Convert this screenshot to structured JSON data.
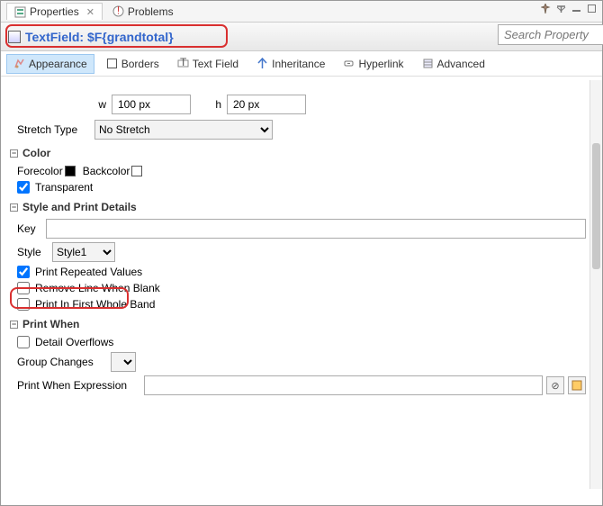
{
  "top_tabs": {
    "properties": "Properties",
    "problems": "Problems"
  },
  "title": "TextField: $F{grandtotal}",
  "search_placeholder": "Search Property",
  "sub_tabs": {
    "appearance": "Appearance",
    "borders": "Borders",
    "text_field": "Text Field",
    "inheritance": "Inheritance",
    "hyperlink": "Hyperlink",
    "advanced": "Advanced"
  },
  "size": {
    "w_label": "w",
    "w_value": "100 px",
    "h_label": "h",
    "h_value": "20 px"
  },
  "stretch": {
    "label": "Stretch Type",
    "value": "No Stretch"
  },
  "color": {
    "header": "Color",
    "forecolor": "Forecolor",
    "backcolor": "Backcolor",
    "transparent": "Transparent"
  },
  "style_section": {
    "header": "Style and Print Details",
    "key_label": "Key",
    "key_value": "",
    "style_label": "Style",
    "style_value": "Style1",
    "print_repeated": "Print Repeated Values",
    "remove_blank": "Remove Line When Blank",
    "print_first_band": "Print In First Whole Band"
  },
  "print_when": {
    "header": "Print When",
    "detail_overflows": "Detail Overflows",
    "group_changes": "Group Changes",
    "expression_label": "Print When Expression",
    "expression_value": ""
  }
}
